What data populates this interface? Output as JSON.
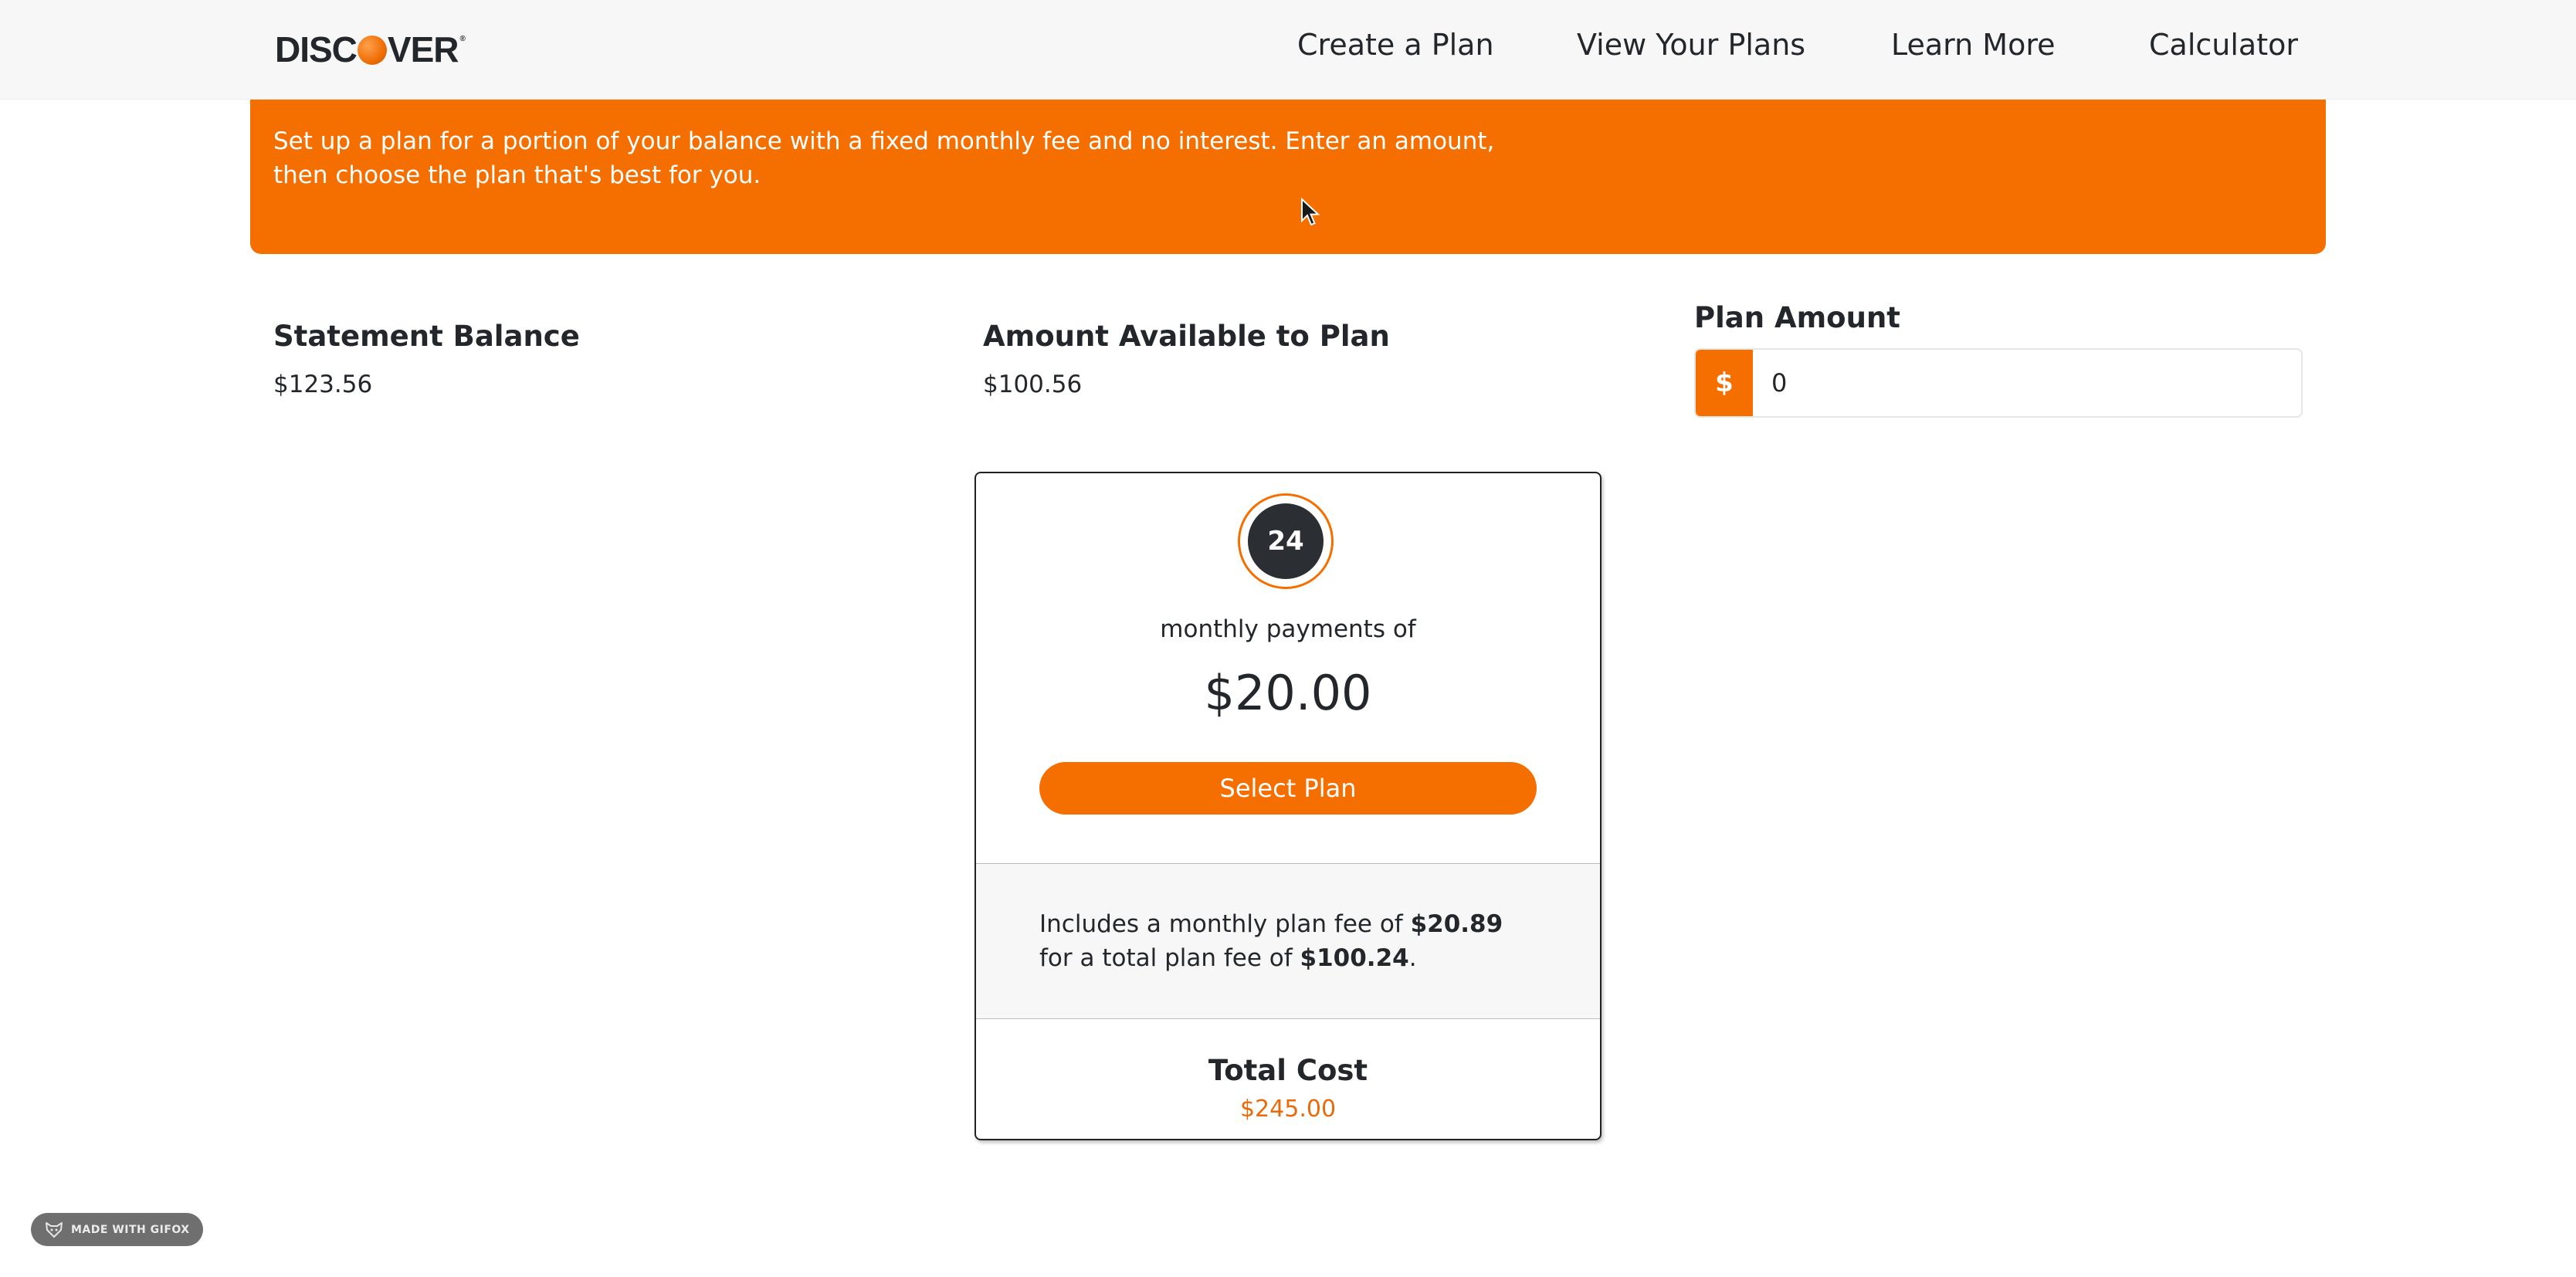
{
  "header": {
    "logo_text": "DISCOVER",
    "nav": [
      "Create a Plan",
      "View Your Plans",
      "Learn More",
      "Calculator"
    ]
  },
  "banner": {
    "text": "Set up a plan for a portion of your balance with a fixed monthly fee and no interest. Enter an amount, then choose the plan that's best for you."
  },
  "stats": {
    "statement_balance_label": "Statement Balance",
    "statement_balance_value": "$123.56",
    "available_label": "Amount Available to Plan",
    "available_value": "$100.56"
  },
  "plan_amount": {
    "label": "Plan Amount",
    "currency_symbol": "$",
    "value": "0"
  },
  "plan_card": {
    "months": "24",
    "subtitle": "monthly payments of",
    "payment": "$20.00",
    "select_label": "Select Plan",
    "fee_prefix": "Includes a monthly plan fee of ",
    "monthly_fee": "$20.89",
    "fee_middle": " for a total plan fee of ",
    "total_fee": "$100.24",
    "fee_suffix": ".",
    "total_cost_label": "Total Cost",
    "total_cost_value": "$245.00"
  },
  "watermark": {
    "text": "MADE WITH GIFOX"
  },
  "colors": {
    "accent": "#f56e00",
    "badge": "#2b2e33",
    "header_bg": "#f7f7f7"
  }
}
